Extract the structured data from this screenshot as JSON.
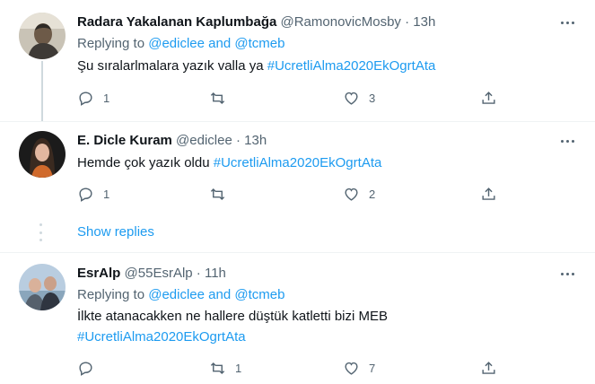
{
  "tweets": [
    {
      "name": "Radara Yakalanan Kaplumbağa",
      "handle": "@RamonovicMosby",
      "dot": "·",
      "time": "13h",
      "replying_label": "Replying to",
      "replying_handles": "@ediclee and @tcmeb",
      "text": "Şu sıralarlmalara yazık valla ya",
      "hashtag": "#UcretliAlma2020EkOgrtAta",
      "reply_count": "1",
      "retweet_count": "",
      "like_count": "3"
    },
    {
      "name": "E. Dicle Kuram",
      "handle": "@ediclee",
      "dot": "·",
      "time": "13h",
      "text": "Hemde çok yazık oldu",
      "hashtag": "#UcretliAlma2020EkOgrtAta",
      "reply_count": "1",
      "retweet_count": "",
      "like_count": "2"
    },
    {
      "name": "EsrAlp",
      "handle": "@55EsrAlp",
      "dot": "·",
      "time": "11h",
      "replying_label": "Replying to",
      "replying_handles": "@ediclee and @tcmeb",
      "text": "İlkte atanacakken ne hallere düştük katletti bizi MEB",
      "hashtag": "#UcretliAlma2020EkOgrtAta",
      "reply_count": "",
      "retweet_count": "1",
      "like_count": "7"
    }
  ],
  "show_replies": "Show replies",
  "icons": {
    "reply": "reply-icon",
    "retweet": "retweet-icon",
    "like": "heart-icon",
    "share": "share-icon",
    "more": "more-icon"
  },
  "colors": {
    "link": "#1d9bf0",
    "muted": "#536471",
    "text": "#0f1419",
    "thread_line": "#cfd9de"
  }
}
